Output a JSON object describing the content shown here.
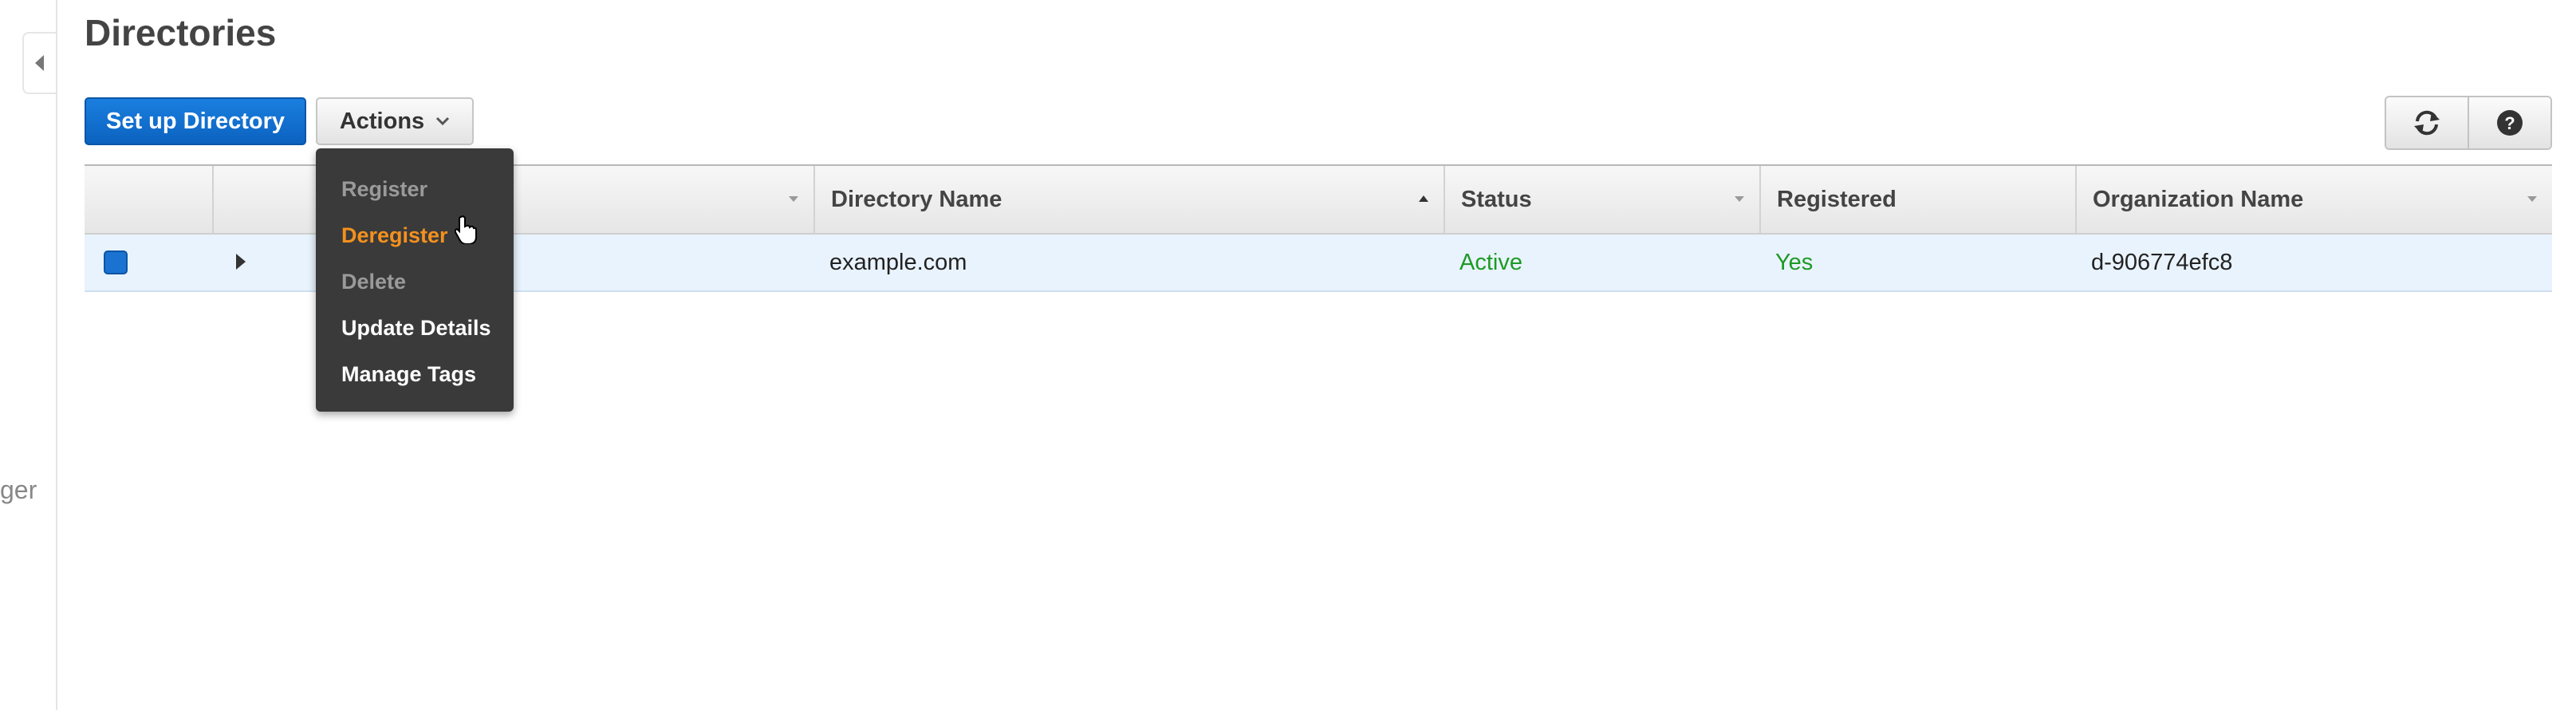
{
  "page": {
    "title": "Directories"
  },
  "sidebar": {
    "partial_text": "ger"
  },
  "toolbar": {
    "setup_label": "Set up Directory",
    "actions_label": "Actions"
  },
  "table": {
    "columns": [
      {
        "label": ""
      },
      {
        "label": ""
      },
      {
        "label": "Directory Name",
        "sort": "ascending"
      },
      {
        "label": "Status"
      },
      {
        "label": "Registered"
      },
      {
        "label": "Organization Name"
      }
    ],
    "rows": [
      {
        "selected": true,
        "directory_name": "example.com",
        "status": "Active",
        "registered": "Yes",
        "organization_name": "d-906774efc8"
      }
    ]
  },
  "actions_menu": {
    "items": [
      {
        "label": "Register",
        "state": "disabled"
      },
      {
        "label": "Deregister",
        "state": "hover"
      },
      {
        "label": "Delete",
        "state": "disabled"
      },
      {
        "label": "Update Details",
        "state": "enabled"
      },
      {
        "label": "Manage Tags",
        "state": "enabled"
      }
    ]
  },
  "colors": {
    "primary": "#0c62bf",
    "status_green": "#1d9a25",
    "menu_bg": "#3a3a3a",
    "menu_hover": "#f3911e",
    "row_selected": "#e9f3fd"
  },
  "icons": {
    "collapse": "caret-left-icon",
    "refresh": "refresh-icon",
    "help": "help-icon",
    "expand": "caret-right-icon",
    "cursor": "hand-pointer-icon"
  }
}
